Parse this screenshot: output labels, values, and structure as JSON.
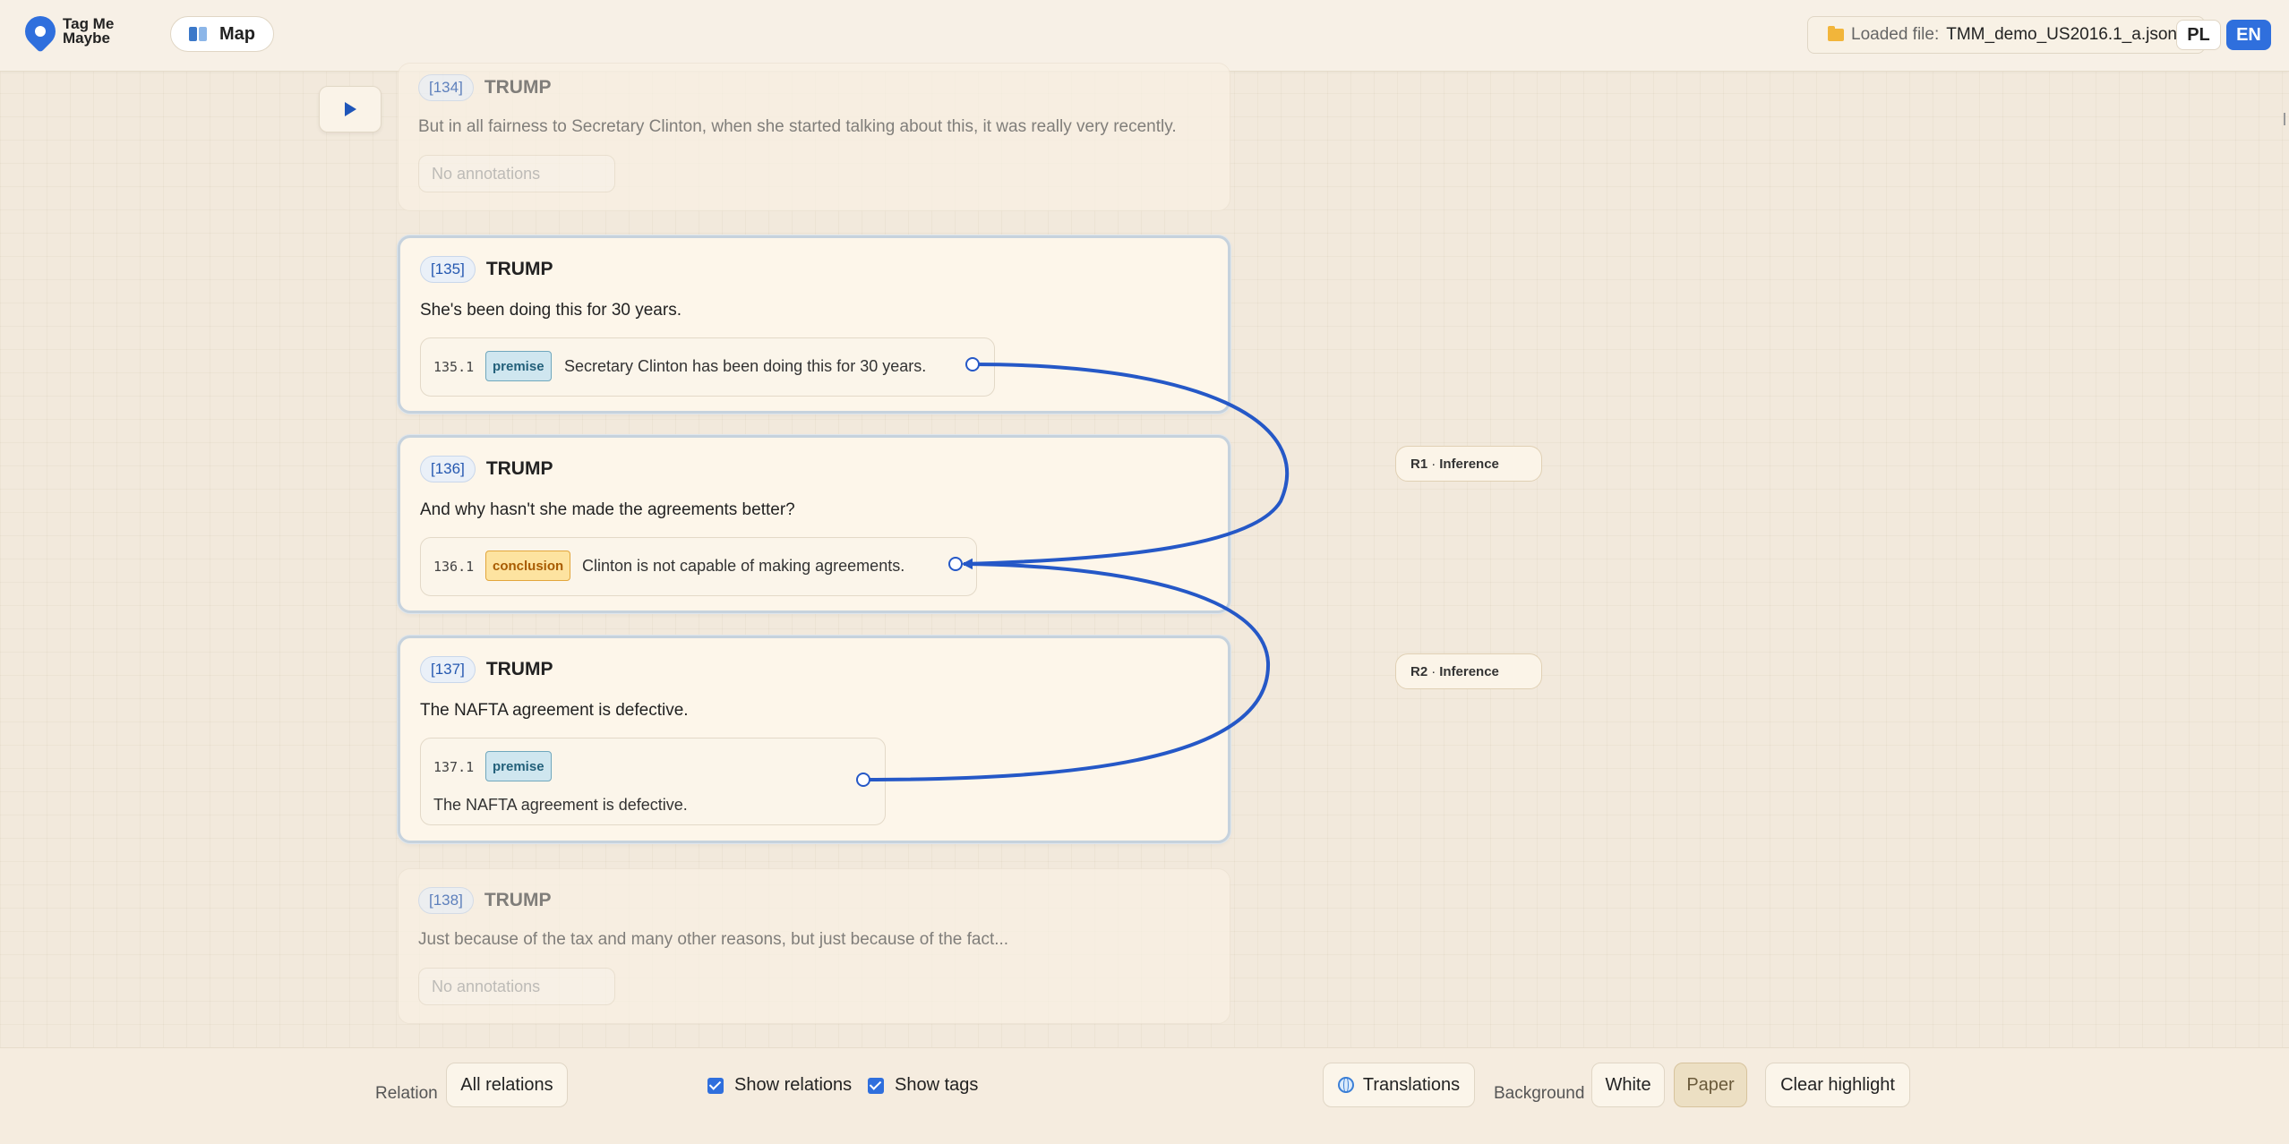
{
  "app": {
    "name": "Tag Me Maybe",
    "name_line1": "Tag Me",
    "name_line2": "Maybe"
  },
  "header": {
    "map_label": "Map",
    "loaded_label": "Loaded file:",
    "loaded_file": "TMM_demo_US2016.1_a.json",
    "languages": [
      "PL",
      "EN"
    ],
    "active_language": "EN"
  },
  "cards": [
    {
      "id": "[134]",
      "speaker": "TRUMP",
      "text": "But in all fairness to Secretary Clinton, when she started talking about this, it was really very recently.",
      "no_annotations": "No annotations"
    },
    {
      "id": "[135]",
      "speaker": "TRUMP",
      "text": "She's been doing this for 30 years.",
      "annotation": {
        "id": "135.1",
        "tag": "premise",
        "text": "Secretary Clinton has been doing this for 30 years."
      }
    },
    {
      "id": "[136]",
      "speaker": "TRUMP",
      "text": "And why hasn't she made the agreements better?",
      "annotation": {
        "id": "136.1",
        "tag": "conclusion",
        "text": "Clinton is not capable of making agreements."
      }
    },
    {
      "id": "[137]",
      "speaker": "TRUMP",
      "text": "The NAFTA agreement is defective.",
      "annotation": {
        "id": "137.1",
        "tag": "premise",
        "text": "The NAFTA agreement is defective."
      }
    },
    {
      "id": "[138]",
      "speaker": "TRUMP",
      "text": "Just because of the tax and many other reasons, but just because of the fact...",
      "no_annotations": "No annotations"
    }
  ],
  "relations": [
    {
      "id": "R1",
      "sep": "·",
      "type": "Inference",
      "from": "135.1",
      "to": "136.1"
    },
    {
      "id": "R2",
      "sep": "·",
      "type": "Inference",
      "from": "137.1",
      "to": "136.1"
    }
  ],
  "colors": {
    "accent": "#2f6fdd",
    "link": "#2558c7",
    "premise": "#cfe6ef",
    "conclusion": "#fde3a0",
    "background": "#f2e9dc"
  },
  "footer": {
    "relation_label": "Relation",
    "relation_value": "All relations",
    "show_relations": {
      "label": "Show relations",
      "checked": true
    },
    "show_tags": {
      "label": "Show tags",
      "checked": true
    },
    "translations": "Translations",
    "background_label": "Background",
    "background_options": [
      "White",
      "Paper"
    ],
    "background_selected": "Paper",
    "clear_highlight": "Clear highlight"
  },
  "icons": {
    "logo": "map-pin-icon",
    "map": "book-icon",
    "file": "folder-icon",
    "play": "play-icon",
    "translations": "globe-icon"
  }
}
